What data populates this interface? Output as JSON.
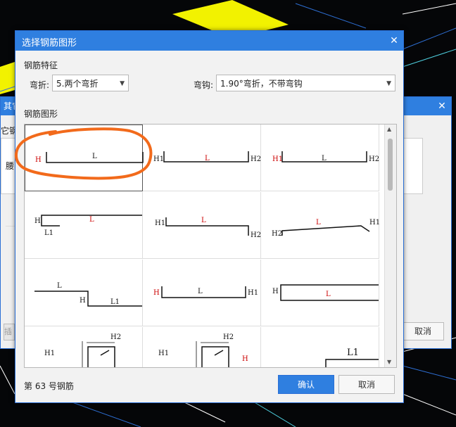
{
  "background_dialog": {
    "title_fragment": "其它",
    "label_fragment": "它钢筋",
    "cell_fragment": "腰",
    "left_button_fragment": "插",
    "cancel_label": "取消"
  },
  "dialog": {
    "title": "选择钢筋图形",
    "close_label": "✕",
    "section_feature": "钢筋特征",
    "bend_label": "弯折:",
    "bend_value": "5.两个弯折",
    "hook_label": "弯钩:",
    "hook_value": "1.90°弯折，不带弯钩",
    "section_shape": "钢筋图形",
    "status": "第 63 号钢筋",
    "ok_label": "确认",
    "cancel_label": "取消"
  },
  "shapes": [
    {
      "labels": [
        "H",
        "L"
      ]
    },
    {
      "labels": [
        "H1",
        "L",
        "H2"
      ]
    },
    {
      "labels": [
        "H1",
        "L",
        "H2"
      ]
    },
    {
      "labels": [
        "H",
        "L",
        "L1"
      ]
    },
    {
      "labels": [
        "H1",
        "L",
        "H2"
      ]
    },
    {
      "labels": [
        "H2",
        "L",
        "H1"
      ]
    },
    {
      "labels": [
        "L",
        "H",
        "L1"
      ]
    },
    {
      "labels": [
        "H",
        "L",
        "H1"
      ]
    },
    {
      "labels": [
        "H",
        "L"
      ]
    },
    {
      "labels": [
        "H1",
        "H2"
      ]
    },
    {
      "labels": [
        "H1",
        "H2",
        "H"
      ]
    },
    {
      "labels": [
        "L1"
      ]
    }
  ],
  "colors": {
    "titlebar": "#2f7fe0",
    "highlight_stroke": "#f26a1b",
    "label_red": "#cc0000"
  }
}
